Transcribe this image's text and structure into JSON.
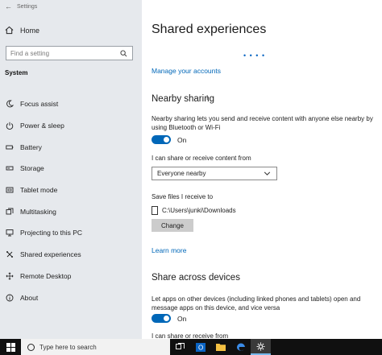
{
  "window": {
    "title": "Settings"
  },
  "sidebar": {
    "home_label": "Home",
    "search_placeholder": "Find a setting",
    "section": "System",
    "items": [
      {
        "label": "Focus assist",
        "icon": "moon-icon"
      },
      {
        "label": "Power & sleep",
        "icon": "power-icon"
      },
      {
        "label": "Battery",
        "icon": "battery-icon"
      },
      {
        "label": "Storage",
        "icon": "storage-icon"
      },
      {
        "label": "Tablet mode",
        "icon": "tablet-icon"
      },
      {
        "label": "Multitasking",
        "icon": "multitasking-icon"
      },
      {
        "label": "Projecting to this PC",
        "icon": "project-icon"
      },
      {
        "label": "Shared experiences",
        "icon": "share-icon"
      },
      {
        "label": "Remote Desktop",
        "icon": "remote-desktop-icon"
      },
      {
        "label": "About",
        "icon": "info-icon"
      }
    ]
  },
  "main": {
    "title": "Shared experiences",
    "loading_dots": "• • • •",
    "manage_accounts": "Manage your accounts",
    "nearby": {
      "title": "Nearby sharing",
      "description": "Nearby sharing lets you send and receive content with anyone else nearby by using Bluetooth or Wi-Fi",
      "toggle_state": "On",
      "share_label": "I can share or receive content from",
      "dropdown_value": "Everyone nearby",
      "save_label": "Save files I receive to",
      "save_path": "C:\\Users\\junki\\Downloads",
      "change_button": "Change",
      "learn_more": "Learn more"
    },
    "across": {
      "title": "Share across devices",
      "description": "Let apps on other devices (including linked phones and tablets) open and message apps on this device, and vice versa",
      "toggle_state": "On",
      "share_label": "I can share or receive from"
    }
  },
  "taskbar": {
    "search_placeholder": "Type here to search",
    "apps": [
      "task-view-icon",
      "outlook-icon",
      "file-explorer-icon",
      "edge-icon",
      "settings-icon"
    ]
  },
  "colors": {
    "accent": "#0067b8",
    "sidebar_bg": "#e6e9ed",
    "taskbar_bg": "#101010"
  }
}
